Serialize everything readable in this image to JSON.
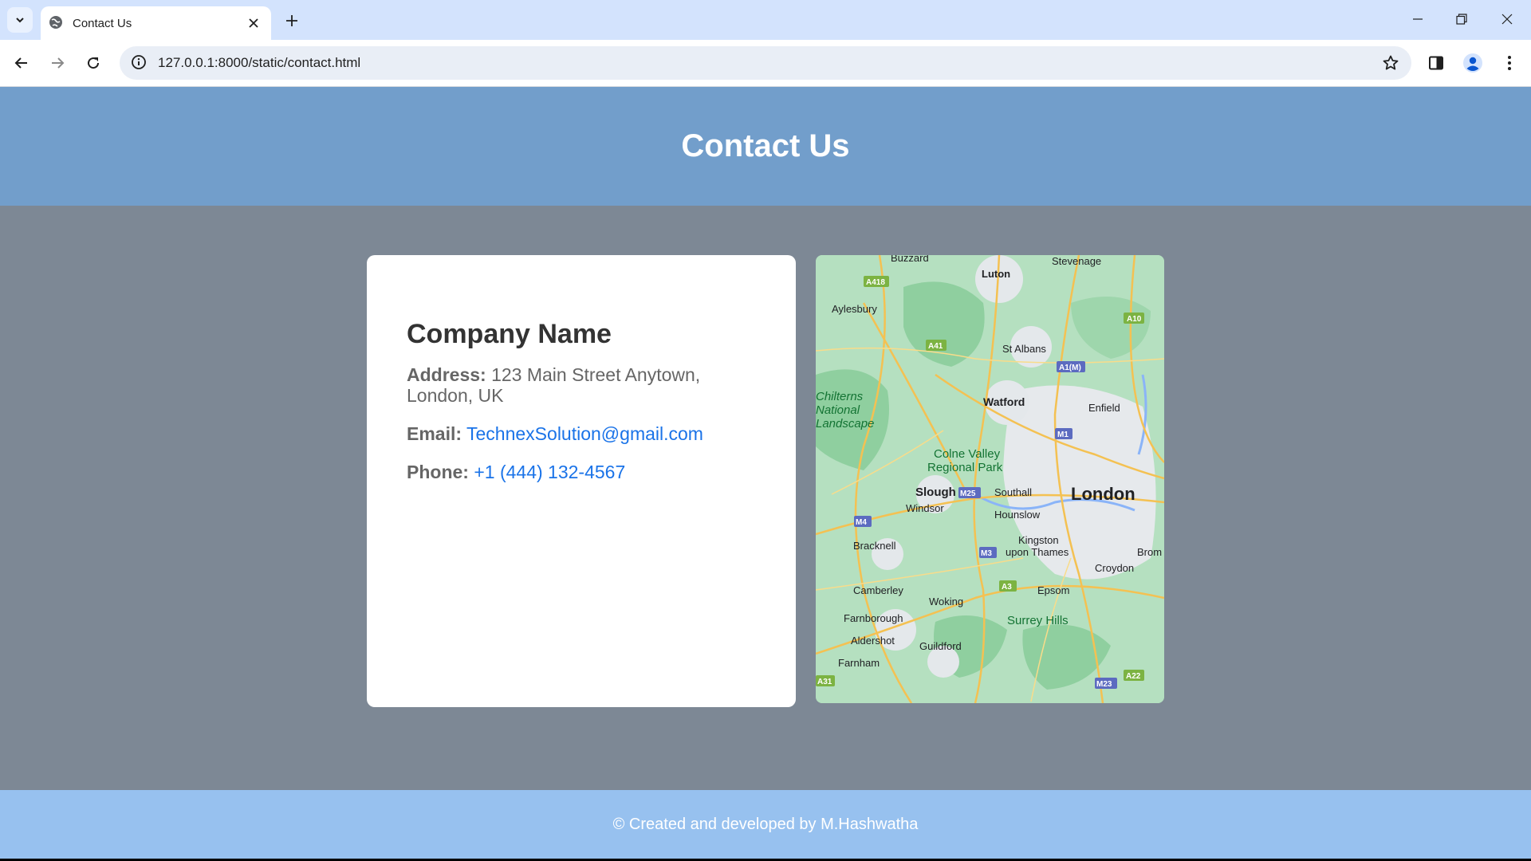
{
  "browser": {
    "tab_title": "Contact Us",
    "url": "127.0.0.1:8000/static/contact.html"
  },
  "page": {
    "header_title": "Contact Us",
    "company_name": "Company Name",
    "address_label": "Address:",
    "address_value": "123 Main Street Anytown, London, UK",
    "email_label": "Email:",
    "email_value": "TechnexSolution@gmail.com",
    "phone_label": "Phone:",
    "phone_value": "+1 (444) 132-4567",
    "footer_text": "© Created and developed by M.Hashwatha"
  },
  "map": {
    "places": [
      "Buzzard",
      "Luton",
      "Stevenage",
      "Aylesbury",
      "St Albans",
      "Chilterns",
      "National",
      "Landscape",
      "Watford",
      "Enfield",
      "Colne Valley",
      "Regional Park",
      "Slough",
      "Southall",
      "London",
      "Windsor",
      "Hounslow",
      "Bracknell",
      "Kingston",
      "upon Thames",
      "Brom",
      "Croydon",
      "Camberley",
      "Woking",
      "Epsom",
      "Farnborough",
      "Surrey Hills",
      "Aldershot",
      "Guildford",
      "Farnham"
    ],
    "roads": [
      "A418",
      "A10",
      "A41",
      "A1(M)",
      "M1",
      "M25",
      "M4",
      "M3",
      "A3",
      "A31",
      "M23",
      "A22"
    ]
  },
  "colors": {
    "header_bg": "#729ecb",
    "body_bg": "#7d8895",
    "footer_bg": "#97c1ef",
    "link": "#1a73e8"
  }
}
